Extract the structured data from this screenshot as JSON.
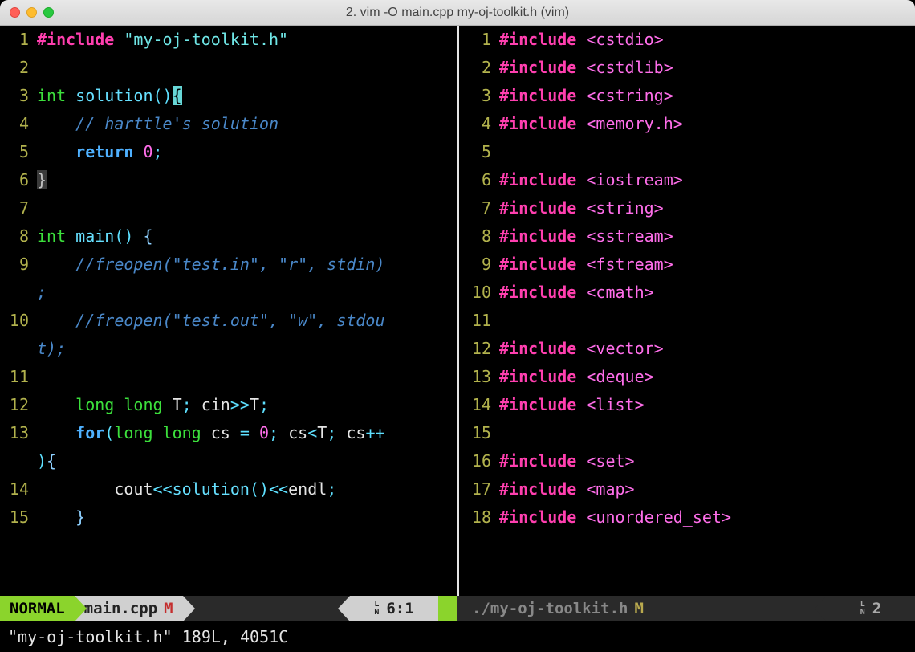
{
  "window": {
    "title": "2. vim -O main.cpp my-oj-toolkit.h (vim)"
  },
  "left_pane": {
    "lines": [
      {
        "n": 1,
        "tokens": [
          [
            "preproc",
            "#include"
          ],
          [
            "plain",
            " "
          ],
          [
            "string",
            "\"my-oj-toolkit.h\""
          ]
        ]
      },
      {
        "n": 2,
        "tokens": []
      },
      {
        "n": 3,
        "tokens": [
          [
            "type",
            "int"
          ],
          [
            "plain",
            " "
          ],
          [
            "func",
            "solution"
          ],
          [
            "punct",
            "()"
          ],
          [
            "cursor",
            "{"
          ]
        ]
      },
      {
        "n": 4,
        "tokens": [
          [
            "plain",
            "    "
          ],
          [
            "comment",
            "// harttle's solution"
          ]
        ]
      },
      {
        "n": 5,
        "tokens": [
          [
            "plain",
            "    "
          ],
          [
            "keyword",
            "return"
          ],
          [
            "plain",
            " "
          ],
          [
            "num",
            "0"
          ],
          [
            "punct",
            ";"
          ]
        ]
      },
      {
        "n": 6,
        "tokens": [
          [
            "hlbrace",
            "}"
          ]
        ]
      },
      {
        "n": 7,
        "tokens": []
      },
      {
        "n": 8,
        "tokens": [
          [
            "type",
            "int"
          ],
          [
            "plain",
            " "
          ],
          [
            "func",
            "main"
          ],
          [
            "punct",
            "()"
          ],
          [
            "plain",
            " "
          ],
          [
            "brace",
            "{"
          ]
        ]
      },
      {
        "n": 9,
        "tokens": [
          [
            "plain",
            "    "
          ],
          [
            "comment",
            "//freopen(\"test.in\", \"r\", stdin)"
          ]
        ]
      },
      {
        "n": null,
        "tokens": [
          [
            "comment",
            ";"
          ]
        ]
      },
      {
        "n": 10,
        "tokens": [
          [
            "plain",
            "    "
          ],
          [
            "comment",
            "//freopen(\"test.out\", \"w\", stdou"
          ]
        ]
      },
      {
        "n": null,
        "tokens": [
          [
            "comment",
            "t);"
          ]
        ]
      },
      {
        "n": 11,
        "tokens": []
      },
      {
        "n": 12,
        "tokens": [
          [
            "plain",
            "    "
          ],
          [
            "type",
            "long long"
          ],
          [
            "plain",
            " T"
          ],
          [
            "punct",
            ";"
          ],
          [
            "plain",
            " cin"
          ],
          [
            "punct",
            ">>"
          ],
          [
            "plain",
            "T"
          ],
          [
            "punct",
            ";"
          ]
        ]
      },
      {
        "n": 13,
        "tokens": [
          [
            "plain",
            "    "
          ],
          [
            "keyword",
            "for"
          ],
          [
            "punct",
            "("
          ],
          [
            "type",
            "long long"
          ],
          [
            "plain",
            " cs "
          ],
          [
            "punct",
            "="
          ],
          [
            "plain",
            " "
          ],
          [
            "num",
            "0"
          ],
          [
            "punct",
            ";"
          ],
          [
            "plain",
            " cs"
          ],
          [
            "punct",
            "<"
          ],
          [
            "plain",
            "T"
          ],
          [
            "punct",
            ";"
          ],
          [
            "plain",
            " cs"
          ],
          [
            "punct",
            "++"
          ]
        ]
      },
      {
        "n": null,
        "tokens": [
          [
            "punct",
            ")"
          ],
          [
            "brace",
            "{"
          ]
        ]
      },
      {
        "n": 14,
        "tokens": [
          [
            "plain",
            "        cout"
          ],
          [
            "punct",
            "<<"
          ],
          [
            "func",
            "solution"
          ],
          [
            "punct",
            "()"
          ],
          [
            "punct",
            "<<"
          ],
          [
            "plain",
            "endl"
          ],
          [
            "punct",
            ";"
          ]
        ]
      },
      {
        "n": 15,
        "tokens": [
          [
            "plain",
            "    "
          ],
          [
            "brace",
            "}"
          ]
        ]
      }
    ]
  },
  "right_pane": {
    "lines": [
      {
        "n": 1,
        "tokens": [
          [
            "preproc",
            "#include"
          ],
          [
            "plain",
            " "
          ],
          [
            "lib",
            "<cstdio>"
          ]
        ]
      },
      {
        "n": 2,
        "tokens": [
          [
            "preproc",
            "#include"
          ],
          [
            "plain",
            " "
          ],
          [
            "lib",
            "<cstdlib>"
          ]
        ]
      },
      {
        "n": 3,
        "tokens": [
          [
            "preproc",
            "#include"
          ],
          [
            "plain",
            " "
          ],
          [
            "lib",
            "<cstring>"
          ]
        ]
      },
      {
        "n": 4,
        "tokens": [
          [
            "preproc",
            "#include"
          ],
          [
            "plain",
            " "
          ],
          [
            "lib",
            "<memory.h>"
          ]
        ]
      },
      {
        "n": 5,
        "tokens": []
      },
      {
        "n": 6,
        "tokens": [
          [
            "preproc",
            "#include"
          ],
          [
            "plain",
            " "
          ],
          [
            "lib",
            "<iostream>"
          ]
        ]
      },
      {
        "n": 7,
        "tokens": [
          [
            "preproc",
            "#include"
          ],
          [
            "plain",
            " "
          ],
          [
            "lib",
            "<string>"
          ]
        ]
      },
      {
        "n": 8,
        "tokens": [
          [
            "preproc",
            "#include"
          ],
          [
            "plain",
            " "
          ],
          [
            "lib",
            "<sstream>"
          ]
        ]
      },
      {
        "n": 9,
        "tokens": [
          [
            "preproc",
            "#include"
          ],
          [
            "plain",
            " "
          ],
          [
            "lib",
            "<fstream>"
          ]
        ]
      },
      {
        "n": 10,
        "tokens": [
          [
            "preproc",
            "#include"
          ],
          [
            "plain",
            " "
          ],
          [
            "lib",
            "<cmath>"
          ]
        ]
      },
      {
        "n": 11,
        "tokens": []
      },
      {
        "n": 12,
        "tokens": [
          [
            "preproc",
            "#include"
          ],
          [
            "plain",
            " "
          ],
          [
            "lib",
            "<vector>"
          ]
        ]
      },
      {
        "n": 13,
        "tokens": [
          [
            "preproc",
            "#include"
          ],
          [
            "plain",
            " "
          ],
          [
            "lib",
            "<deque>"
          ]
        ]
      },
      {
        "n": 14,
        "tokens": [
          [
            "preproc",
            "#include"
          ],
          [
            "plain",
            " "
          ],
          [
            "lib",
            "<list>"
          ]
        ]
      },
      {
        "n": 15,
        "tokens": []
      },
      {
        "n": 16,
        "tokens": [
          [
            "preproc",
            "#include"
          ],
          [
            "plain",
            " "
          ],
          [
            "lib",
            "<set>"
          ]
        ]
      },
      {
        "n": 17,
        "tokens": [
          [
            "preproc",
            "#include"
          ],
          [
            "plain",
            " "
          ],
          [
            "lib",
            "<map>"
          ]
        ]
      },
      {
        "n": 18,
        "tokens": [
          [
            "preproc",
            "#include"
          ],
          [
            "plain",
            " "
          ],
          [
            "lib",
            "<unordered_set>"
          ]
        ]
      }
    ]
  },
  "status_left": {
    "mode": "NORMAL",
    "file": "main.cpp",
    "modified": "M",
    "ln_glyph": "L\nN",
    "position": "6:1"
  },
  "status_right": {
    "file": "./my-oj-toolkit.h",
    "modified": "M",
    "ln_glyph": "L\nN",
    "position": "2"
  },
  "cmdline": "\"my-oj-toolkit.h\" 189L, 4051C"
}
